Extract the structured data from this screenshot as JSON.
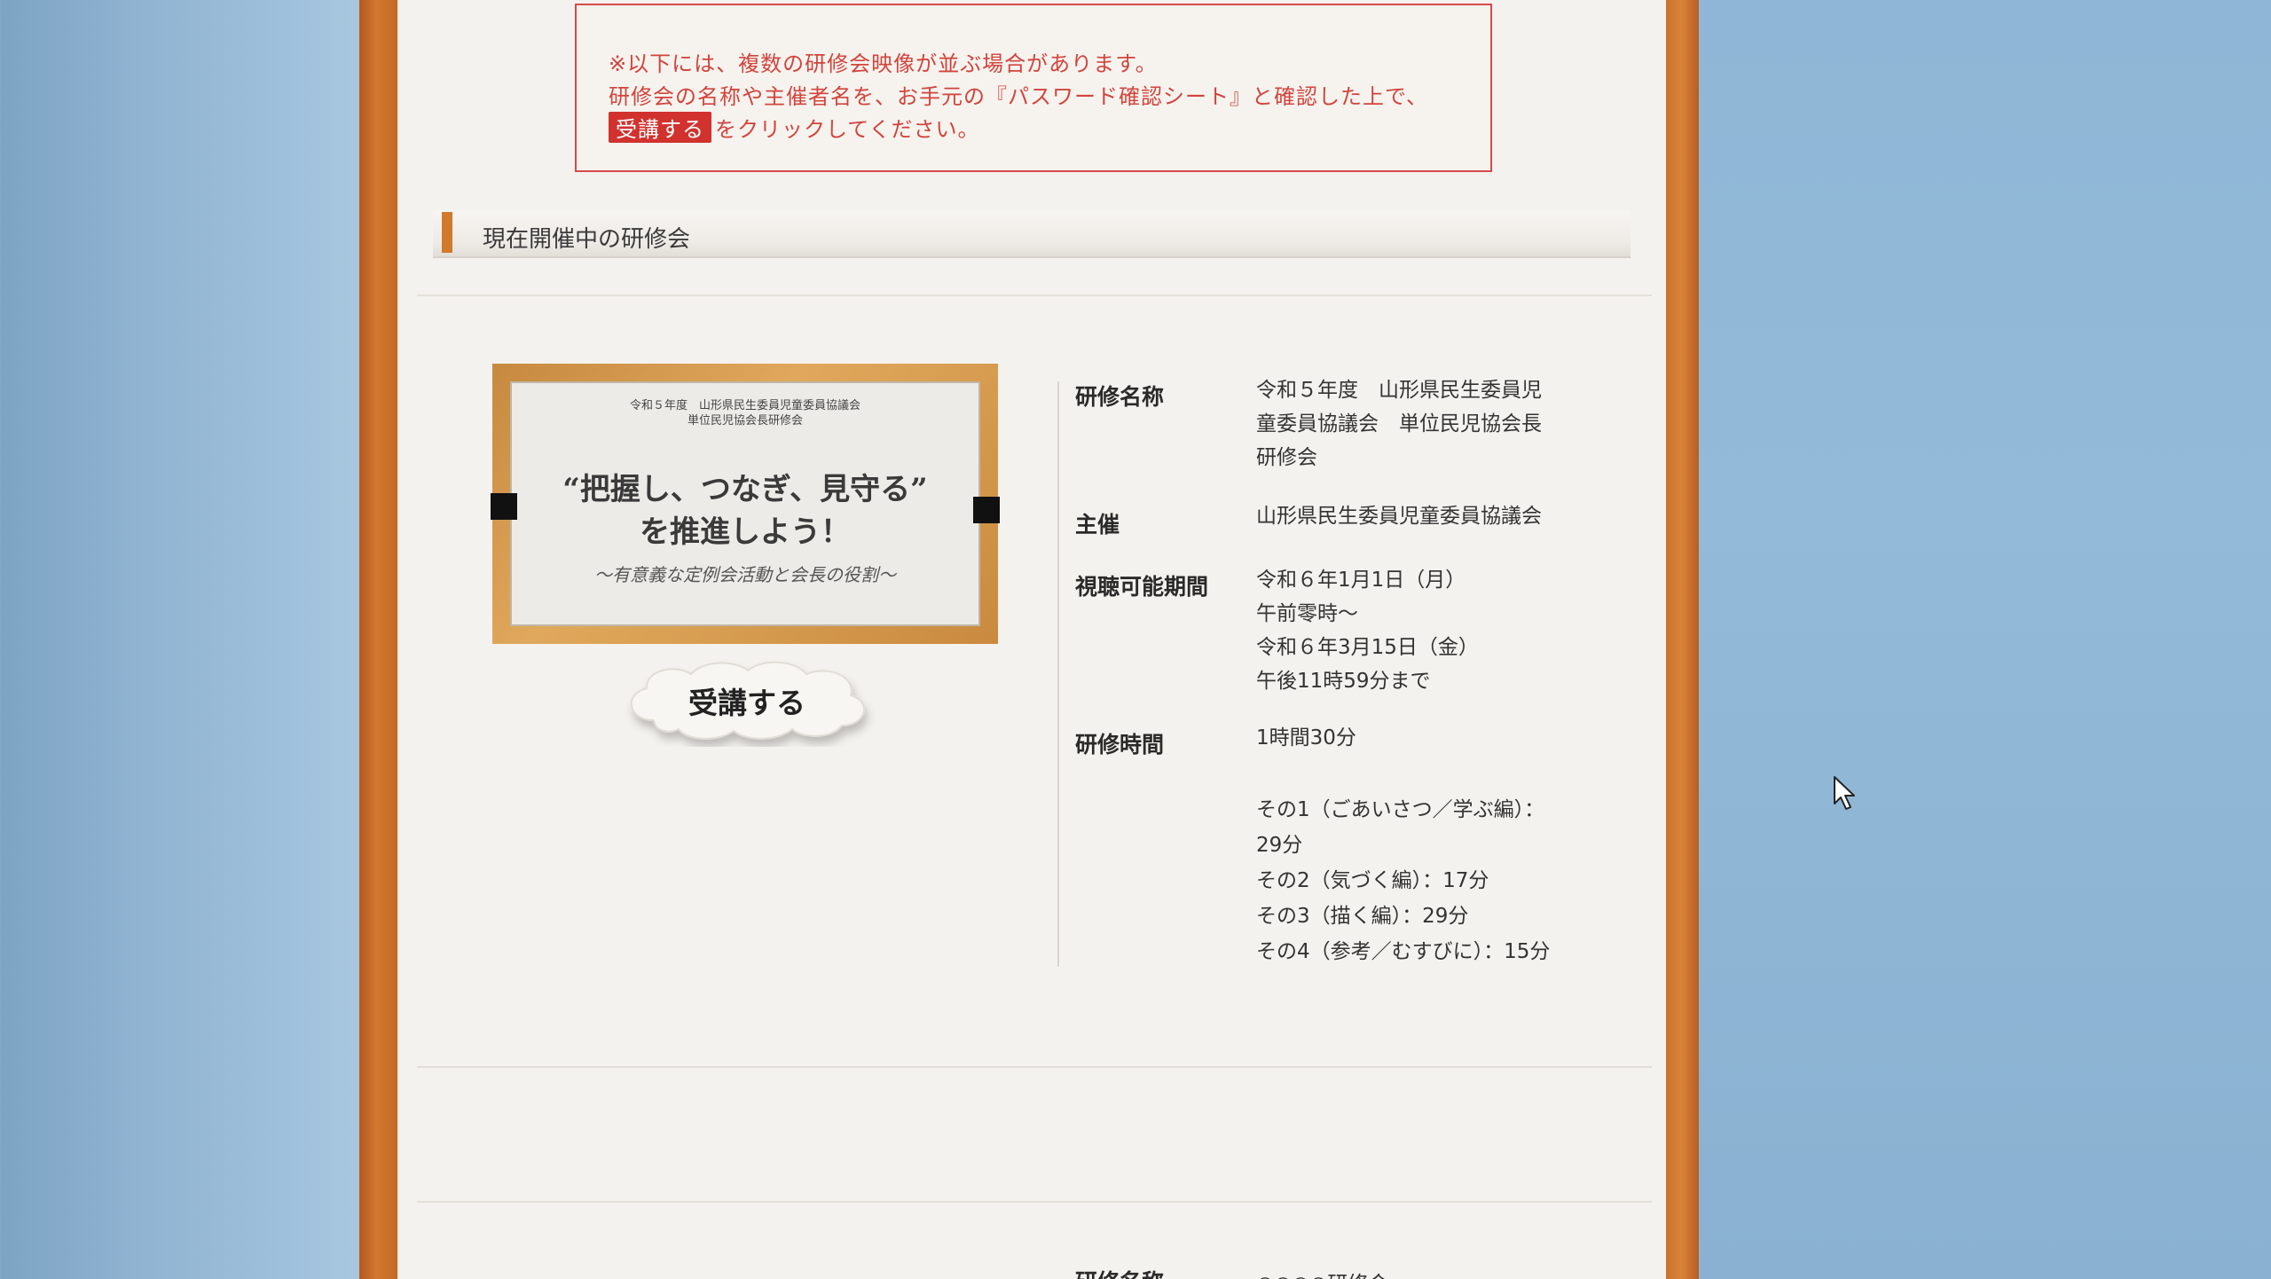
{
  "notice": {
    "line1": "※以下には、複数の研修会映像が並ぶ場合があります。",
    "line2": "研修会の名称や主催者名を、お手元の『パスワード確認シート』と確認した上で、",
    "line3_badge": "受講する",
    "line3_text": "をクリックしてください。"
  },
  "section": {
    "title": "現在開催中の研修会"
  },
  "thumbnail": {
    "small_line1": "令和５年度　山形県民生委員児童委員協議会",
    "small_line2": "単位民児協会長研修会",
    "main_line1": "“把握し、つなぎ、見守る”",
    "main_line2": "を推進しよう！",
    "subtitle": "～有意義な定例会活動と会長の役割～"
  },
  "enroll_button": {
    "label": "受講する"
  },
  "details": {
    "name_label": "研修名称",
    "name_value_lines": [
      "令和５年度　山形県民生委員児",
      "童委員協議会　単位民児協会長",
      "研修会"
    ],
    "host_label": "主催",
    "host_value": "山形県民生委員児童委員協議会",
    "period_label": "視聴可能期間",
    "period_lines": [
      "令和６年1月1日（月）",
      "午前零時～",
      "令和６年3月15日（金）",
      "午後11時59分まで"
    ],
    "time_label": "研修時間",
    "time_value": "1時間30分",
    "parts": [
      "その1（ごあいさつ／学ぶ編）：",
      "29分",
      "その2（気づく編）：17分",
      "その3（描く編）：29分",
      "その4（参考／むすびに）：15分"
    ]
  },
  "next_item": {
    "name_label": "研修名称",
    "name_value": "○○○○研修会"
  },
  "icons": {
    "cursor": "mouse-pointer-icon"
  }
}
